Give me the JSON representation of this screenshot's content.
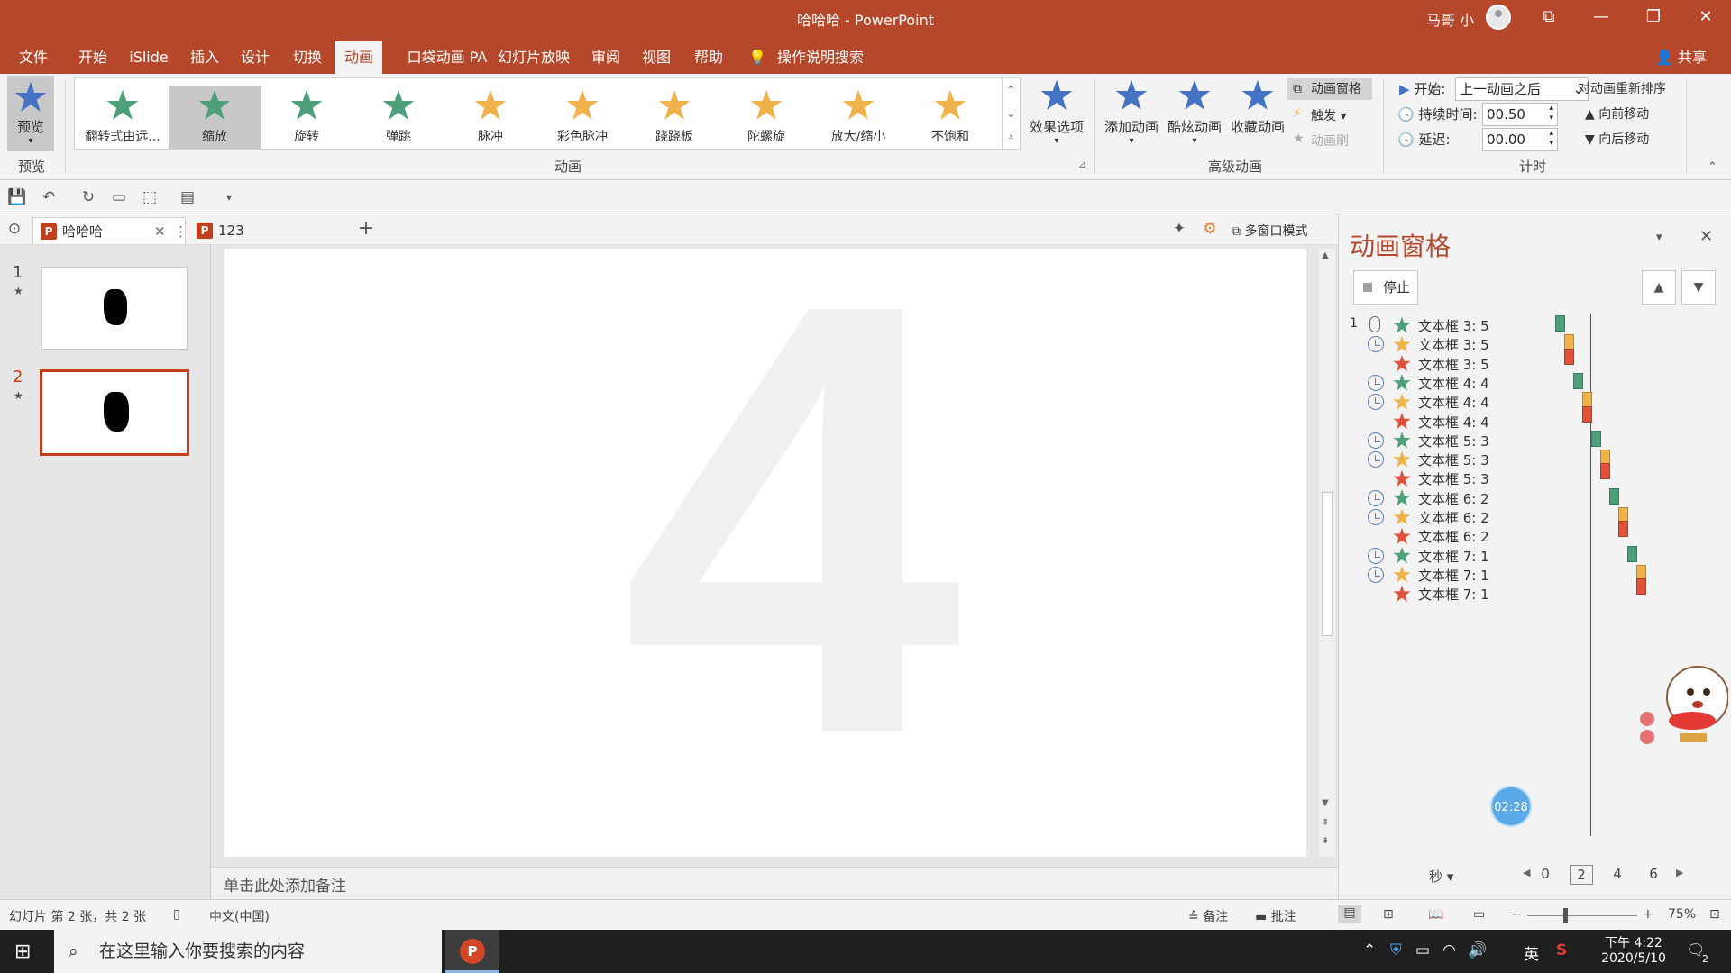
{
  "window": {
    "title": "哈哈哈 - PowerPoint",
    "user": "马哥 小",
    "share": "共享"
  },
  "tabs": [
    "文件",
    "开始",
    "iSlide",
    "插入",
    "设计",
    "切换",
    "动画",
    "口袋动画 PA",
    "幻灯片放映",
    "审阅",
    "视图",
    "帮助",
    "操作说明搜索"
  ],
  "ribbon": {
    "preview": "预览",
    "preview_group": "预览",
    "gallery": [
      {
        "label": "翻转式由远...",
        "color": "#4ea07a"
      },
      {
        "label": "缩放",
        "color": "#4ea07a"
      },
      {
        "label": "旋转",
        "color": "#4ea07a"
      },
      {
        "label": "弹跳",
        "color": "#4ea07a"
      },
      {
        "label": "脉冲",
        "color": "#f0b24a"
      },
      {
        "label": "彩色脉冲",
        "color": "#f0b24a"
      },
      {
        "label": "跷跷板",
        "color": "#f0b24a"
      },
      {
        "label": "陀螺旋",
        "color": "#f0b24a"
      },
      {
        "label": "放大/缩小",
        "color": "#f0b24a"
      },
      {
        "label": "不饱和",
        "color": "#f0b24a"
      }
    ],
    "effect_options": "效果选项",
    "animation_group": "动画",
    "add_animation": "添加动画",
    "cool_animation": "酷炫动画",
    "fav_animation": "收藏动画",
    "anim_pane": "动画窗格",
    "trigger": "触发",
    "anim_painter": "动画刷",
    "advanced_group": "高级动画",
    "start_label": "开始:",
    "start_value": "上一动画之后",
    "duration_label": "持续时间:",
    "duration_value": "00.50",
    "delay_label": "延迟:",
    "delay_value": "00.00",
    "reorder": "对动画重新排序",
    "move_earlier": "向前移动",
    "move_later": "向后移动",
    "timing_group": "计时"
  },
  "doc_tabs": [
    {
      "name": "哈哈哈",
      "active": true
    },
    {
      "name": "123",
      "active": false
    }
  ],
  "multi_window": "多窗口模式",
  "slides": [
    {
      "number": "1",
      "mark": "★"
    },
    {
      "number": "2",
      "mark": "★"
    }
  ],
  "slide_text": "4",
  "notes_placeholder": "单击此处添加备注",
  "pane": {
    "title": "动画窗格",
    "stop": "停止",
    "items": [
      {
        "num": "1",
        "trigger": "mouse",
        "color": "#4ea07a",
        "label": "文本框 3: 5"
      },
      {
        "num": "",
        "trigger": "clock",
        "color": "#f0b24a",
        "label": "文本框 3: 5"
      },
      {
        "num": "",
        "trigger": "none",
        "color": "#e0533a",
        "label": "文本框 3: 5"
      },
      {
        "num": "",
        "trigger": "clock",
        "color": "#4ea07a",
        "label": "文本框 4: 4"
      },
      {
        "num": "",
        "trigger": "clock",
        "color": "#f0b24a",
        "label": "文本框 4: 4"
      },
      {
        "num": "",
        "trigger": "none",
        "color": "#e0533a",
        "label": "文本框 4: 4"
      },
      {
        "num": "",
        "trigger": "clock",
        "color": "#4ea07a",
        "label": "文本框 5: 3"
      },
      {
        "num": "",
        "trigger": "clock",
        "color": "#f0b24a",
        "label": "文本框 5: 3"
      },
      {
        "num": "",
        "trigger": "none",
        "color": "#e0533a",
        "label": "文本框 5: 3"
      },
      {
        "num": "",
        "trigger": "clock",
        "color": "#4ea07a",
        "label": "文本框 6: 2"
      },
      {
        "num": "",
        "trigger": "clock",
        "color": "#f0b24a",
        "label": "文本框 6: 2"
      },
      {
        "num": "",
        "trigger": "none",
        "color": "#e0533a",
        "label": "文本框 6: 2"
      },
      {
        "num": "",
        "trigger": "clock",
        "color": "#4ea07a",
        "label": "文本框 7: 1"
      },
      {
        "num": "",
        "trigger": "clock",
        "color": "#f0b24a",
        "label": "文本框 7: 1"
      },
      {
        "num": "",
        "trigger": "none",
        "color": "#e0533a",
        "label": "文本框 7: 1"
      }
    ],
    "time_bubble": "02:28",
    "seconds": "秒",
    "scale": [
      "0",
      "2",
      "4",
      "6"
    ]
  },
  "status": {
    "slide_info": "幻灯片 第 2 张，共 2 张",
    "language": "中文(中国)",
    "notes": "备注",
    "comments": "批注",
    "zoom": "75%"
  },
  "taskbar": {
    "search_placeholder": "在这里输入你要搜索的内容",
    "ime": "英",
    "time": "下午 4:22",
    "date": "2020/5/10",
    "notif_count": "2"
  }
}
